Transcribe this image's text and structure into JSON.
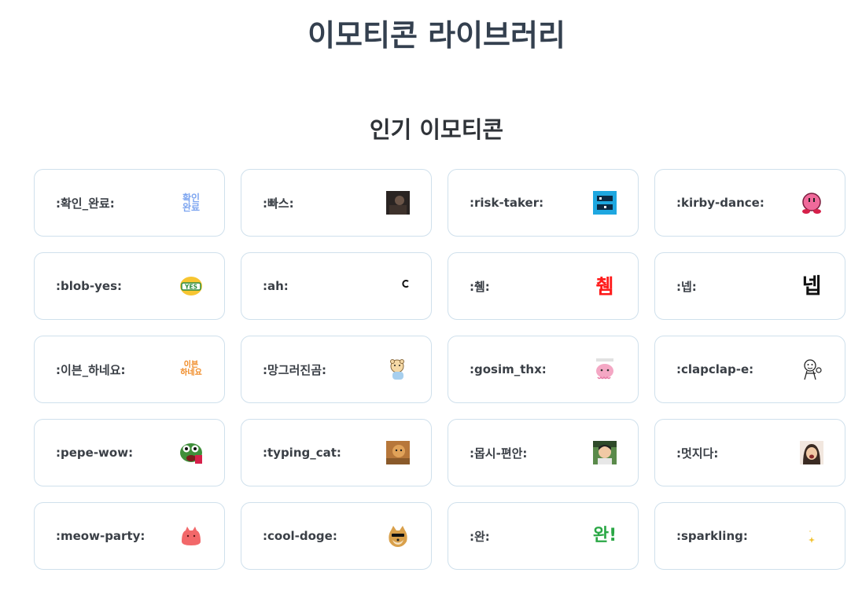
{
  "page": {
    "title": "이모티콘 라이브러리",
    "section_title": "인기 이모티콘"
  },
  "emoticons": [
    {
      "label": ":확인_완료:",
      "icon": "confirm-done-text-icon",
      "glyph_line1": "확인",
      "glyph_line2": "완료",
      "color": "#7ea6f0"
    },
    {
      "label": ":빠스:",
      "icon": "dark-photo-icon"
    },
    {
      "label": ":risk-taker:",
      "icon": "risk-taker-badge-icon",
      "color": "#1ea7e0"
    },
    {
      "label": ":kirby-dance:",
      "icon": "kirby-icon",
      "color": "#f06a9b"
    },
    {
      "label": ":blob-yes:",
      "icon": "blob-yes-icon",
      "glyph": "YES",
      "color": "#f7c531"
    },
    {
      "label": ":ah:",
      "icon": "small-c-mark-icon"
    },
    {
      "label": ":췜:",
      "icon": "chwem-text-icon",
      "glyph": "췜",
      "color": "#ff1a1a"
    },
    {
      "label": ":넵:",
      "icon": "nep-text-icon",
      "glyph": "넵",
      "color": "#111111"
    },
    {
      "label": ":이븐_하네요:",
      "icon": "even-text-icon",
      "glyph_line1": "이븐",
      "glyph_line2": "하네요",
      "color": "#f08a24"
    },
    {
      "label": ":망그러진곰:",
      "icon": "broken-bear-icon"
    },
    {
      "label": ":gosim_thx:",
      "icon": "pink-octopus-icon",
      "color": "#f4a7c4"
    },
    {
      "label": ":clapclap-e:",
      "icon": "clapping-doodle-icon"
    },
    {
      "label": ":pepe-wow:",
      "icon": "pepe-frog-icon",
      "color": "#3f8f3a"
    },
    {
      "label": ":typing_cat:",
      "icon": "typing-cat-photo-icon",
      "color": "#c9823a"
    },
    {
      "label": ":몹시-편안:",
      "icon": "comfy-person-photo-icon"
    },
    {
      "label": ":멋지다:",
      "icon": "cool-person-photo-icon"
    },
    {
      "label": ":meow-party:",
      "icon": "pink-cat-blob-icon",
      "color": "#f2686a"
    },
    {
      "label": ":cool-doge:",
      "icon": "doge-sunglasses-icon",
      "color": "#d9a04b"
    },
    {
      "label": ":완:",
      "icon": "wan-text-icon",
      "glyph": "완!",
      "color": "#2aa745"
    },
    {
      "label": ":sparkling:",
      "icon": "sparkle-icon",
      "color": "#f2c230"
    }
  ]
}
